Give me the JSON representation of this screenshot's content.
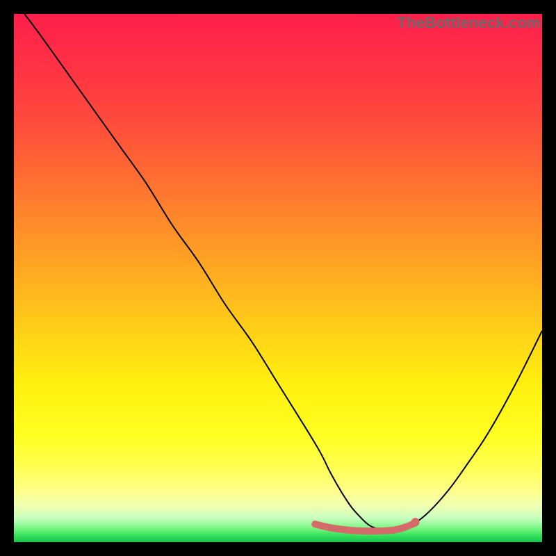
{
  "watermark": "TheBottleneck.com",
  "chart_data": {
    "type": "line",
    "title": "",
    "xlabel": "",
    "ylabel": "",
    "xlim": [
      0,
      100
    ],
    "ylim": [
      0,
      100
    ],
    "axes_visible": false,
    "background_gradient": {
      "stops": [
        {
          "offset": 0.0,
          "color": "#ff1f4b"
        },
        {
          "offset": 0.1,
          "color": "#ff3244"
        },
        {
          "offset": 0.2,
          "color": "#ff4a3c"
        },
        {
          "offset": 0.3,
          "color": "#ff6a33"
        },
        {
          "offset": 0.4,
          "color": "#ff8c2a"
        },
        {
          "offset": 0.5,
          "color": "#ffae21"
        },
        {
          "offset": 0.6,
          "color": "#ffd018"
        },
        {
          "offset": 0.7,
          "color": "#fff00f"
        },
        {
          "offset": 0.8,
          "color": "#ffff22"
        },
        {
          "offset": 0.86,
          "color": "#ffff55"
        },
        {
          "offset": 0.9,
          "color": "#ffff88"
        },
        {
          "offset": 0.93,
          "color": "#f2ffb0"
        },
        {
          "offset": 0.955,
          "color": "#c8ffc0"
        },
        {
          "offset": 0.975,
          "color": "#73f57e"
        },
        {
          "offset": 0.988,
          "color": "#33e05a"
        },
        {
          "offset": 1.0,
          "color": "#17c24c"
        }
      ]
    },
    "series": [
      {
        "name": "bottleneck-curve",
        "color": "#000000",
        "stroke_width": 2,
        "x": [
          2,
          5,
          10,
          15,
          20,
          25,
          30,
          35,
          40,
          45,
          50,
          55,
          58,
          60,
          62,
          64,
          66,
          67,
          68,
          70,
          72,
          75,
          78,
          82,
          86,
          90,
          95,
          100
        ],
        "y": [
          100,
          96,
          89,
          82,
          75,
          68,
          60,
          53,
          45,
          38,
          30,
          22,
          17,
          13,
          9.5,
          6.5,
          4.3,
          3.4,
          2.8,
          2.3,
          2.4,
          3.2,
          5.2,
          9.5,
          15,
          21,
          30,
          40
        ]
      }
    ],
    "highlight_band": {
      "name": "optimal-range",
      "color": "#d56a6a",
      "stroke_width": 10,
      "x": [
        57,
        60,
        63,
        66,
        69,
        72,
        74,
        76
      ],
      "y": [
        3.4,
        2.7,
        2.3,
        2.1,
        2.1,
        2.3,
        2.8,
        3.6
      ]
    },
    "highlight_dot": {
      "name": "optimal-marker",
      "color": "#d56a6a",
      "radius": 6,
      "x": 76,
      "y": 3.8
    }
  }
}
